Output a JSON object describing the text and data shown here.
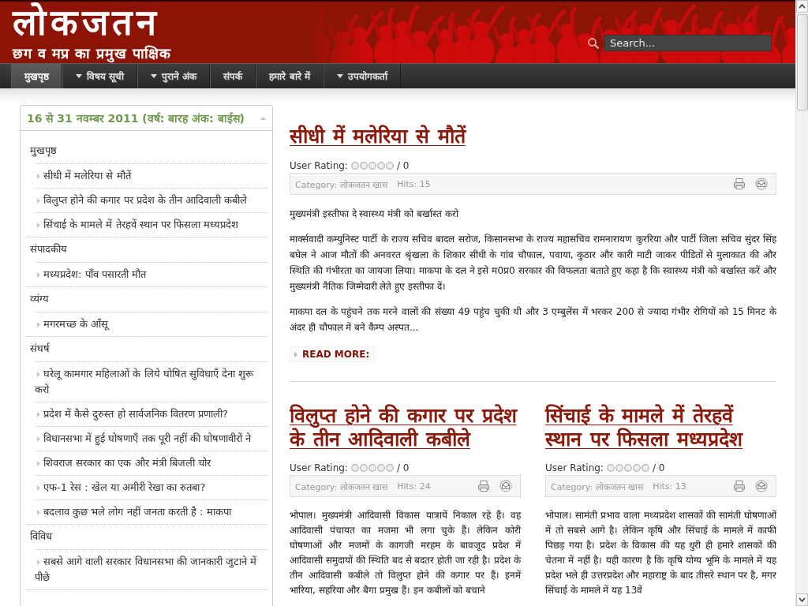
{
  "header": {
    "logo": "लोकजतन",
    "tagline": "छग व मप्र का प्रमुख पाक्षिक",
    "search": {
      "placeholder": "Search..."
    }
  },
  "nav": [
    {
      "label": "मुखपृष्ठ",
      "selected": true,
      "dropdown": false
    },
    {
      "label": "विषय सूची",
      "selected": false,
      "dropdown": true
    },
    {
      "label": "पुराने अंक",
      "selected": false,
      "dropdown": true
    },
    {
      "label": "संपर्क",
      "selected": false,
      "dropdown": false
    },
    {
      "label": "हमारे बारे में",
      "selected": false,
      "dropdown": false
    },
    {
      "label": "उपयोगकर्ता",
      "selected": false,
      "dropdown": true
    }
  ],
  "sidebar": {
    "title": "16 से 31 नवम्बर 2011 (वर्ष: बारह अंक: बाईस)",
    "items": [
      {
        "label": "मुखपृष्ठ",
        "children": [
          {
            "label": "सीधी में मलेरिया से मौतें"
          },
          {
            "label": "विलुप्त होने की कगार पर प्रदेश के तीन आदिवाली कबीले"
          },
          {
            "label": "सिंचाई के मामले में तेरहवें स्थान पर फिसला मध्यप्रदेश"
          }
        ]
      },
      {
        "label": "संपादकीय",
        "children": [
          {
            "label": "मध्यप्रदेश: पाँव पसारती मौत"
          }
        ]
      },
      {
        "label": "व्यंग्य",
        "children": [
          {
            "label": "मगरमच्छ के आँसू"
          }
        ]
      },
      {
        "label": "संघर्ष",
        "children": [
          {
            "label": "घरेलू कामगार महिलाओं के लिये घोषित सुविधाएँ देना शुरू करो"
          },
          {
            "label": "प्रदेश में कैसे दुरुस्त हो सार्वजनिक वितरण प्रणाली?"
          },
          {
            "label": "विधानसभा में हुई घोषणाएँ तक पूरी नहीं की घोषणावीरों ने"
          },
          {
            "label": "शिवराज सरकार का एक और मंत्री बिजली चोर"
          },
          {
            "label": "एफ-1 रेस : खेल या अमीरी रेखा का रुतबा?"
          },
          {
            "label": "बदलाव कुछ भले लोग नहीं जनता करती है : माकपा"
          }
        ]
      },
      {
        "label": "विविध",
        "children": [
          {
            "label": "सबसे आगे वाली सरकार विधानसभा की जानकारी जुटाने में पीछे"
          }
        ]
      }
    ]
  },
  "articles": [
    {
      "kind": "lead",
      "title": "सीधी में मलेरिया से मौतें",
      "rating": {
        "label": "User Rating:",
        "stars": 0,
        "count": "/ 0"
      },
      "category": "Category: लोकजतन खास",
      "hits": "Hits: 15",
      "paragraphs": [
        "मुख्यमंत्री इस्तीफा दे स्वास्थ्य मंत्री को बर्खास्त करो",
        "मार्क्सवादी कम्युनिस्ट पार्टी के राज्य सचिव बादल सरोज, किसानसभा के राज्य महासचिव रामनारायण कुररिया और पार्टी जिला सचिव सुंदर सिंह बघेल ने आज मौतों की अनवरत श्रृंखला के शिकार सीधी के गांव चौफाल, पवाया, कुठार और कारी माटी जाकर पीडितों से मुलाकात की और स्थिति की गंभीरता का जायजा लिया। माकपा के दल ने इसे म0प्र0 सरकार की विफलता बताते हुए कहा है कि स्वास्थ्य मंत्री को बर्खास्त करें और मुख्यमंत्री नैतिक जिम्मेदारी लेते हुए इस्तीफा दें।",
        "माकपा दल के पहुंचने तक मरने वालों की संख्या 49 पहुंच चुकी थी और 3 एम्बुलेंस में भरकर 200 से ज्यादा गंभीर रोगियों को 15 मिनट के अंदर ही चौफाल में बने कैम्प अस्पत..."
      ],
      "read_more": "READ MORE:"
    },
    {
      "kind": "column",
      "title": "विलुप्त होने की कगार पर प्रदेश के तीन आदिवाली कबीले",
      "rating": {
        "label": "User Rating:",
        "stars": 0,
        "count": "/ 0"
      },
      "category": "Category: लोकजतन खास",
      "hits": "Hits: 24",
      "paragraphs": [
        "भोपाल। मुख्यमंत्री आदिवासी विकास यात्रायें निकाल रहे हैं। वह आदिवासी पंचायत का मजमा भी लगा चुके हैं। लेकिन कोरी घोषणाओं और मजमों के कागजी मरहम के बावजूद प्रदेश में आदिवासी समुदायों की स्थिति बद से बदतर होती जा रही है। प्रदेश के तीन आदिवासी कबीले तो विलुप्त होने की कगार पर हैं। इनमें भारिया, सहरिया और बैगा प्रमुख हैं। इन कबीलों को बचाने"
      ]
    },
    {
      "kind": "column",
      "title": "सिंचाई के मामले में तेरहवें स्थान पर फिसला मध्यप्रदेश",
      "rating": {
        "label": "User Rating:",
        "stars": 0,
        "count": "/ 0"
      },
      "category": "Category: लोकजतन खास",
      "hits": "Hits: 13",
      "paragraphs": [
        "भोपाल। सामंती प्रभाव वाला मध्यप्रदेश शासकों की सामंती घोषणाओं में तो सबसे आगे है। लेकिन कृषि और सिंचाई के मामले में काफी पिछड़ गया है। प्रदेश के विकास की यह धुरी ही हमारे शासकों की चेतना में नहीं है। यही कारण है कि कृषि योग्य भूमि के मामले में यह प्रदेश भले ही उत्तरप्रदेश और महाराष्ट्र के बाद तीसरे स्थान पर है, मगर सिंचाई के मामले में यह 13वें"
      ]
    }
  ]
}
